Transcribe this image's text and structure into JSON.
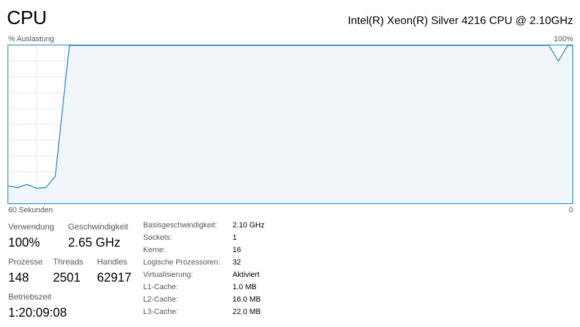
{
  "header": {
    "title": "CPU",
    "cpu_model": "Intel(R) Xeon(R) Silver 4216 CPU @ 2.10GHz"
  },
  "graph": {
    "utilization_label": "% Auslastung",
    "max_label": "100%",
    "time_label": "60 Sekunden",
    "min_label": "0",
    "line_color": "#117dbb",
    "fill_color": "#f1f6fa",
    "grid_color": "#d9eaf4"
  },
  "chart_data": {
    "type": "area",
    "xlabel": "",
    "ylabel": "",
    "xlim": [
      60,
      0
    ],
    "ylim": [
      0,
      100
    ],
    "grid": true,
    "series": [
      {
        "values": [
          [
            60,
            11
          ],
          [
            59,
            10
          ],
          [
            58,
            12
          ],
          [
            57,
            9.5
          ],
          [
            56,
            10
          ],
          [
            55,
            17
          ],
          [
            53.5,
            100
          ],
          [
            2.5,
            100
          ],
          [
            1.5,
            90
          ],
          [
            0.5,
            100
          ],
          [
            0,
            100
          ]
        ]
      }
    ]
  },
  "stats": {
    "usage": {
      "label": "Verwendung",
      "value": "100%"
    },
    "speed": {
      "label": "Geschwindigkeit",
      "value": "2.65 GHz"
    },
    "processes": {
      "label": "Prozesse",
      "value": "148"
    },
    "threads": {
      "label": "Threads",
      "value": "2501"
    },
    "handles": {
      "label": "Handles",
      "value": "62917"
    },
    "uptime": {
      "label": "Betriebszeit",
      "value": "1:20:09:08"
    }
  },
  "details": [
    {
      "key": "Basisgeschwindigkeit:",
      "value": "2.10 GHz"
    },
    {
      "key": "Sockets:",
      "value": "1"
    },
    {
      "key": "Kerne:",
      "value": "16"
    },
    {
      "key": "Logische Prozessoren:",
      "value": "32"
    },
    {
      "key": "Virtualisierung:",
      "value": "Aktiviert"
    },
    {
      "key": "L1-Cache:",
      "value": "1.0 MB"
    },
    {
      "key": "L2-Cache:",
      "value": "16.0 MB"
    },
    {
      "key": "L3-Cache:",
      "value": "22.0 MB"
    }
  ]
}
